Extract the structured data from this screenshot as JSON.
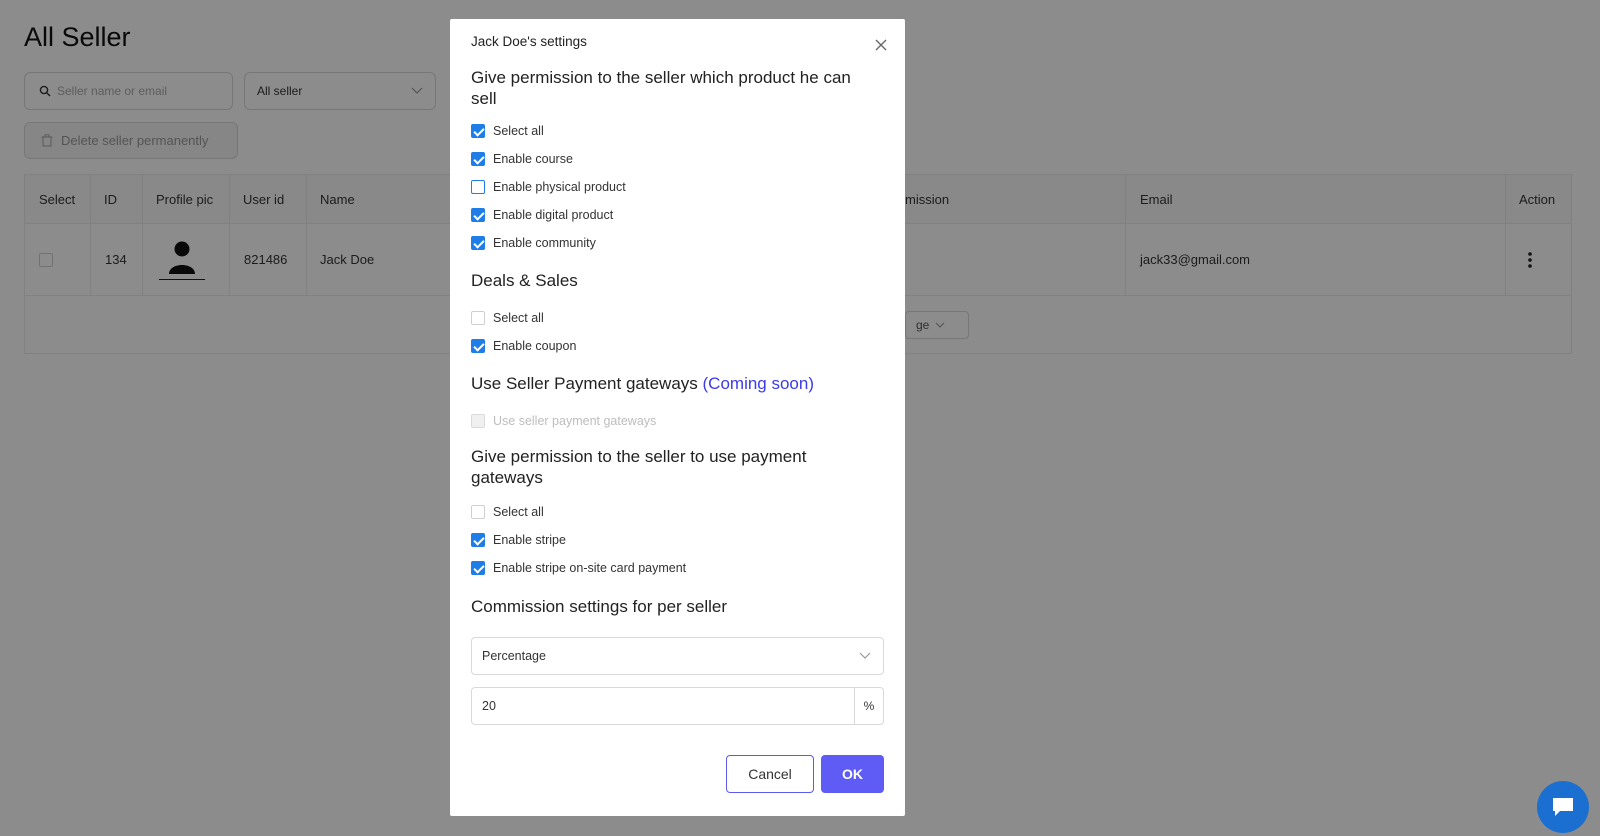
{
  "page": {
    "title": "All Seller",
    "search_placeholder": "Seller name or email",
    "filter_value": "All seller",
    "delete_button": "Delete seller permanently",
    "page_size_label": "ge"
  },
  "table": {
    "headers": {
      "select": "Select",
      "id": "ID",
      "profile_pic": "Profile pic",
      "user_id": "User id",
      "name": "Name",
      "commission": "mission",
      "email": "Email",
      "action": "Action"
    },
    "rows": [
      {
        "id": "134",
        "user_id": "821486",
        "name": "Jack Doe",
        "email": "jack33@gmail.com"
      }
    ]
  },
  "modal": {
    "title": "Jack Doe's settings",
    "product_section": {
      "title": "Give permission to the seller which product he can sell",
      "items": [
        {
          "label": "Select all",
          "checked": true
        },
        {
          "label": "Enable course",
          "checked": true
        },
        {
          "label": "Enable physical product",
          "checked": false
        },
        {
          "label": "Enable digital product",
          "checked": true
        },
        {
          "label": "Enable community",
          "checked": true
        }
      ]
    },
    "deals_section": {
      "title": "Deals & Sales",
      "items": [
        {
          "label": "Select all",
          "checked": false
        },
        {
          "label": "Enable coupon",
          "checked": true
        }
      ]
    },
    "seller_gateways_section": {
      "title": "Use Seller Payment gateways",
      "coming_soon": "(Coming soon)",
      "items": [
        {
          "label": "Use seller payment gateways",
          "checked": false,
          "disabled": true
        }
      ]
    },
    "payment_section": {
      "title": "Give permission to the seller to use payment gateways",
      "items": [
        {
          "label": "Select all",
          "checked": false
        },
        {
          "label": "Enable stripe",
          "checked": true
        },
        {
          "label": "Enable stripe on-site card payment",
          "checked": true
        }
      ]
    },
    "commission_section": {
      "title": "Commission settings for per seller",
      "type_value": "Percentage",
      "amount_value": "20",
      "amount_suffix": "%"
    },
    "cancel_label": "Cancel",
    "ok_label": "OK"
  },
  "colors": {
    "accent": "#5e5cf4",
    "checkbox": "#1e7de6",
    "coming_soon": "#3b3be8",
    "chat": "#1a6fd1"
  }
}
